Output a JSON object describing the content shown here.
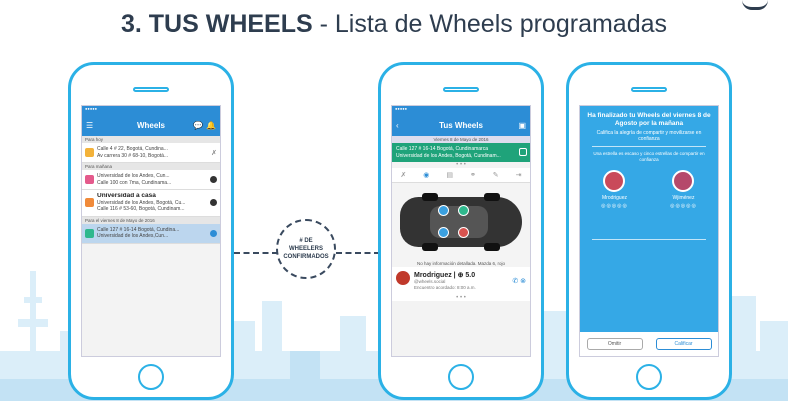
{
  "slide": {
    "title_bold": "3. TUS WHEELS",
    "title_rest": " - Lista de Wheels programadas"
  },
  "colors": {
    "accent": "#2bb1e6",
    "nav": "#2c8dd6",
    "green": "#1fa37a",
    "dark": "#2e3d4f"
  },
  "badge": {
    "line1": "# DE WHEELERS",
    "line2": "CONFIRMADOS"
  },
  "phone1": {
    "title": "Wheels",
    "sections": [
      {
        "label": "Para hoy",
        "trips": [
          {
            "line1": "Calle 4 # 22, Bogotá, Cundina...",
            "line2": "Av carrera 30 # 68-10, Bogotá...",
            "color": "#f3b23a"
          }
        ]
      },
      {
        "label": "Para mañana",
        "trips": [
          {
            "line1": "Universidad de los Andes, Cun...",
            "line2": "Calle 100 con 7ma, Cundinama...",
            "color": "#e45a8c"
          },
          {
            "title": "Universidad a casa",
            "line1": "Universidad de los Andes, Bogotá, Cu...",
            "line2": "Calle 116 # 53-60, Bogotá, Cundinam...",
            "color": "#f08a3a"
          }
        ]
      },
      {
        "label": "Para el viernes 8 de Mayo de 2016",
        "trips": [
          {
            "line1": "Calle 127 # 16-14 Bogotá, Cundina...",
            "line2": "Universidad de los Andes,Cun...",
            "color": "#2fb88d"
          }
        ]
      }
    ]
  },
  "phone2": {
    "title": "Tus Wheels",
    "date": "Viernes 8 de Mayo de 2016",
    "route_line1": "Calle 127 # 16-14 Bogotá, Cundinamarca",
    "route_line2": "Universidad de los Andes, Bogotá, Cundinam...",
    "car_note": "No hay información detallada. Mazda 6, rojo",
    "driver_name": "Mrodriguez | ⊕ 5.0",
    "driver_handle": "@wheels.social",
    "driver_status": "Encuentro acordado: 8:00 a.m."
  },
  "phone3": {
    "heading": "Ha finalizado tu Wheels del viernes 8 de Agosto por la mañana",
    "sub": "Califica la alegría de compartir y movilizarse en confianza",
    "sub2": "Una estrella es escaso y cinco estrellas de compartir en confianza",
    "people": [
      {
        "name": "Mrodriguez",
        "color": "#c94a5a"
      },
      {
        "name": "Wjiménez",
        "color": "#b5496b"
      }
    ],
    "stars": "◎◎◎◎◎",
    "omit_label": "Omitir",
    "rate_label": "Calificar"
  }
}
